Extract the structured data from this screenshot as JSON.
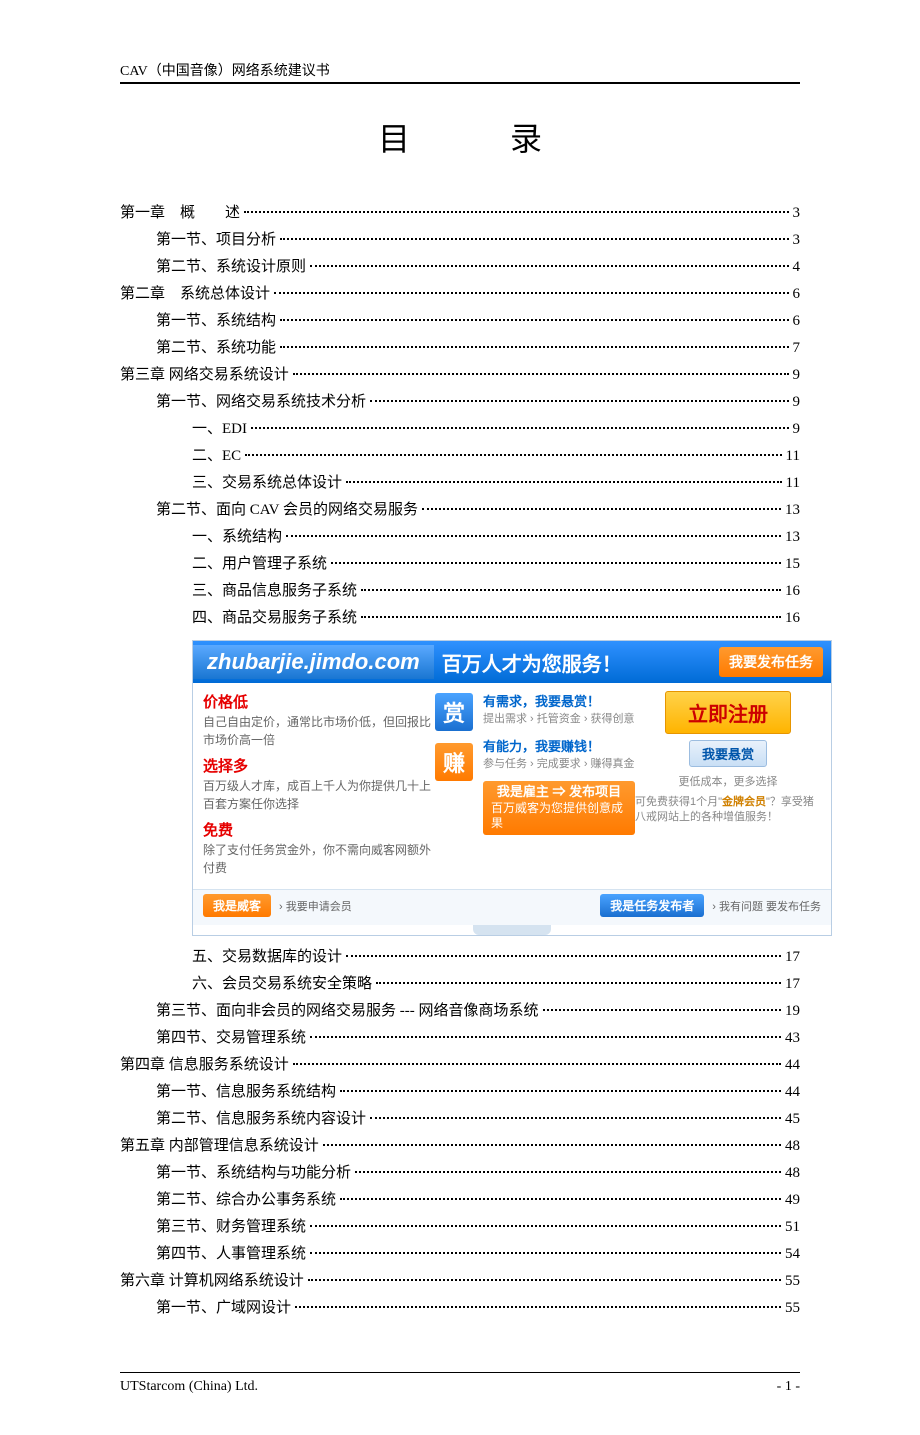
{
  "header": "CAV（中国音像）网络系统建议书",
  "title": "目录",
  "toc": [
    {
      "i": 0,
      "label": "第一章　概　　述",
      "page": "3"
    },
    {
      "i": 1,
      "label": "第一节、项目分析",
      "page": "3"
    },
    {
      "i": 1,
      "label": "第二节、系统设计原则",
      "page": "4"
    },
    {
      "i": 0,
      "label": "第二章　系统总体设计",
      "page": "6"
    },
    {
      "i": 1,
      "label": "第一节、系统结构",
      "page": "6"
    },
    {
      "i": 1,
      "label": "第二节、系统功能",
      "page": "7"
    },
    {
      "i": 0,
      "label": "第三章 网络交易系统设计",
      "page": "9"
    },
    {
      "i": 1,
      "label": "第一节、网络交易系统技术分析",
      "page": "9"
    },
    {
      "i": 2,
      "label": "一、EDI",
      "page": "9"
    },
    {
      "i": 2,
      "label": "二、EC",
      "page": "11"
    },
    {
      "i": 2,
      "label": "三、交易系统总体设计",
      "page": "11"
    },
    {
      "i": 1,
      "label": "第二节、面向 CAV 会员的网络交易服务",
      "page": "13"
    },
    {
      "i": 2,
      "label": "一、系统结构",
      "page": "13"
    },
    {
      "i": 2,
      "label": "二、用户管理子系统",
      "page": "15"
    },
    {
      "i": 2,
      "label": "三、商品信息服务子系统",
      "page": "16"
    },
    {
      "i": 2,
      "label": "四、商品交易服务子系统",
      "page": "16"
    }
  ],
  "toc2": [
    {
      "i": 2,
      "label": "五、交易数据库的设计",
      "page": "17"
    },
    {
      "i": 2,
      "label": "六、会员交易系统安全策略",
      "page": "17"
    },
    {
      "i": 1,
      "label": "第三节、面向非会员的网络交易服务 --- 网络音像商场系统",
      "page": "19"
    },
    {
      "i": 1,
      "label": "第四节、交易管理系统",
      "page": "43"
    },
    {
      "i": 0,
      "label": "第四章 信息服务系统设计",
      "page": "44"
    },
    {
      "i": 1,
      "label": "第一节、信息服务系统结构",
      "page": "44"
    },
    {
      "i": 1,
      "label": "第二节、信息服务系统内容设计",
      "page": "45"
    },
    {
      "i": 0,
      "label": "第五章 内部管理信息系统设计",
      "page": "48"
    },
    {
      "i": 1,
      "label": "第一节、系统结构与功能分析",
      "page": "48"
    },
    {
      "i": 1,
      "label": "第二节、综合办公事务系统",
      "page": "49"
    },
    {
      "i": 1,
      "label": "第三节、财务管理系统",
      "page": "51"
    },
    {
      "i": 1,
      "label": "第四节、人事管理系统",
      "page": "54"
    },
    {
      "i": 0,
      "label": "第六章 计算机网络系统设计",
      "page": "55"
    },
    {
      "i": 1,
      "label": "第一节、广域网设计",
      "page": "55"
    }
  ],
  "ad": {
    "url": "zhubarjie.jimdo.com",
    "slogan": "百万人才为您服务！",
    "publish_task": "我要发布任务",
    "left": [
      {
        "h": "价格低",
        "p": "自己自由定价，通常比市场价低，但回报比市场价高一倍"
      },
      {
        "h": "选择多",
        "p": "百万级人才库，成百上千人为你提供几十上百套方案任你选择"
      },
      {
        "h": "免费",
        "p": "除了支付任务赏金外，你不需向威客网额外付费"
      }
    ],
    "tile1": "赏",
    "tile2": "赚",
    "mid": [
      {
        "t": "有需求，我要悬赏！",
        "s": "提出需求 › 托管资金 › 获得创意"
      },
      {
        "t": "有能力，我要赚钱！",
        "s": "参与任务 › 完成要求 › 赚得真金"
      }
    ],
    "register": "立即注册",
    "xs_btn": "我要悬赏",
    "xs_sub": "更低成本，更多选择",
    "pub_main": "我是雇主 ⇒ 发布项目",
    "pub_sub": "百万威客为您提供创意成果",
    "gold_a": "可免费获得1个月\"",
    "gold_b": "金牌会员",
    "gold_c": "\"？享受猪八戒网站上的各种增值服务！",
    "f1": "我是威客",
    "f1t": "› 我要申请会员",
    "f2": "我是任务发布者",
    "f2t": "› 我有问题 要发布任务"
  },
  "footer": {
    "left": "UTStarcom (China) Ltd.",
    "right": "- 1 -"
  }
}
